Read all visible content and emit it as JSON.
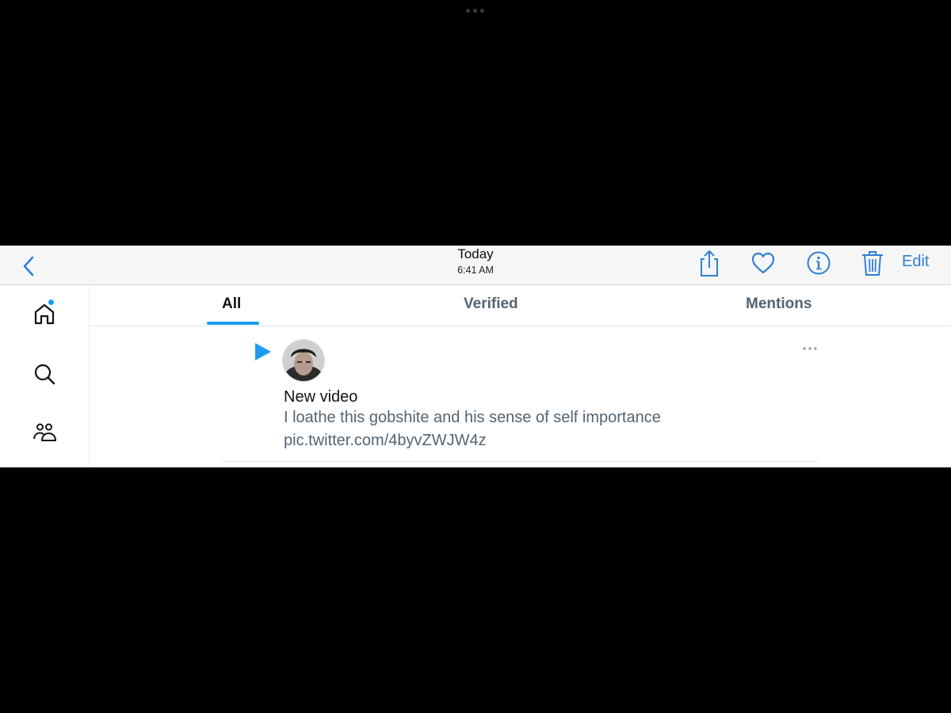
{
  "header": {
    "title": "Today",
    "subtitle": "6:41 AM",
    "edit_label": "Edit"
  },
  "icons": {
    "back": "chevron-left-icon",
    "share": "share-icon",
    "like": "heart-icon",
    "info": "info-icon",
    "delete": "trash-icon",
    "home": "home-icon",
    "search": "search-icon",
    "people": "people-icon",
    "play": "play-icon",
    "more": "more-icon"
  },
  "colors": {
    "accent": "#1d9bf0",
    "nav_blue": "#2f80d6",
    "muted_text": "#536471"
  },
  "tabs": [
    {
      "label": "All",
      "active": true
    },
    {
      "label": "Verified",
      "active": false
    },
    {
      "label": "Mentions",
      "active": false
    }
  ],
  "notification": {
    "title": "New video",
    "text": "I loathe this gobshite and his sense of self importance",
    "link": "pic.twitter.com/4byvZWJW4z"
  }
}
